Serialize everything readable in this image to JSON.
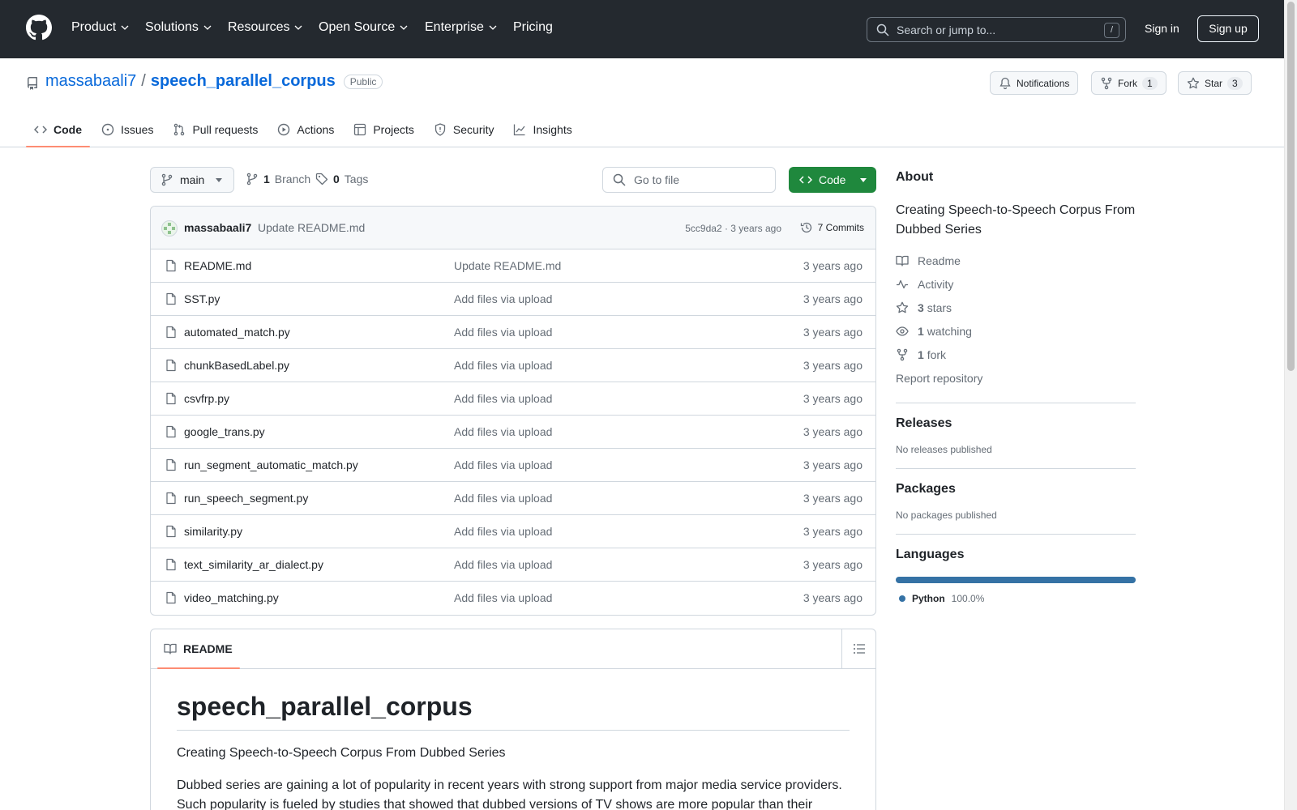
{
  "header": {
    "nav": [
      {
        "label": "Product",
        "has_menu": true
      },
      {
        "label": "Solutions",
        "has_menu": true
      },
      {
        "label": "Resources",
        "has_menu": true
      },
      {
        "label": "Open Source",
        "has_menu": true
      },
      {
        "label": "Enterprise",
        "has_menu": true
      },
      {
        "label": "Pricing",
        "has_menu": false
      }
    ],
    "search_placeholder": "Search or jump to...",
    "search_shortcut": "/",
    "sign_in": "Sign in",
    "sign_up": "Sign up"
  },
  "repo": {
    "owner": "massabaali7",
    "separator": "/",
    "name": "speech_parallel_corpus",
    "visibility": "Public",
    "notifications_label": "Notifications",
    "fork_label": "Fork",
    "fork_count": "1",
    "star_label": "Star",
    "star_count": "3"
  },
  "tabs": [
    {
      "label": "Code",
      "icon": "code-icon",
      "active": true
    },
    {
      "label": "Issues",
      "icon": "issue-icon",
      "active": false
    },
    {
      "label": "Pull requests",
      "icon": "pull-request-icon",
      "active": false
    },
    {
      "label": "Actions",
      "icon": "play-icon",
      "active": false
    },
    {
      "label": "Projects",
      "icon": "table-icon",
      "active": false
    },
    {
      "label": "Security",
      "icon": "shield-icon",
      "active": false
    },
    {
      "label": "Insights",
      "icon": "graph-icon",
      "active": false
    }
  ],
  "toolbar": {
    "branch": "main",
    "branch_count": "1",
    "branch_word": "Branch",
    "tag_count": "0",
    "tag_word": "Tags",
    "goto_placeholder": "Go to file",
    "code_label": "Code"
  },
  "latest_commit": {
    "author": "massabaali7",
    "message": "Update README.md",
    "meta": "5cc9da2 · 3 years ago",
    "commits": "7 Commits"
  },
  "files": [
    {
      "name": "README.md",
      "message": "Update README.md",
      "time": "3 years ago"
    },
    {
      "name": "SST.py",
      "message": "Add files via upload",
      "time": "3 years ago"
    },
    {
      "name": "automated_match.py",
      "message": "Add files via upload",
      "time": "3 years ago"
    },
    {
      "name": "chunkBasedLabel.py",
      "message": "Add files via upload",
      "time": "3 years ago"
    },
    {
      "name": "csvfrp.py",
      "message": "Add files via upload",
      "time": "3 years ago"
    },
    {
      "name": "google_trans.py",
      "message": "Add files via upload",
      "time": "3 years ago"
    },
    {
      "name": "run_segment_automatic_match.py",
      "message": "Add files via upload",
      "time": "3 years ago"
    },
    {
      "name": "run_speech_segment.py",
      "message": "Add files via upload",
      "time": "3 years ago"
    },
    {
      "name": "similarity.py",
      "message": "Add files via upload",
      "time": "3 years ago"
    },
    {
      "name": "text_similarity_ar_dialect.py",
      "message": "Add files via upload",
      "time": "3 years ago"
    },
    {
      "name": "video_matching.py",
      "message": "Add files via upload",
      "time": "3 years ago"
    }
  ],
  "readme": {
    "tab_label": "README",
    "title": "speech_parallel_corpus",
    "subtitle": "Creating Speech-to-Speech Corpus From Dubbed Series",
    "paragraph": "Dubbed series are gaining a lot of popularity in recent years with strong support from major media service providers. Such popularity is fueled by studies that showed that dubbed versions of TV shows are more popular than their"
  },
  "sidebar": {
    "about_title": "About",
    "description": "Creating Speech-to-Speech Corpus From Dubbed Series",
    "readme_label": "Readme",
    "activity_label": "Activity",
    "stars_count": "3",
    "stars_word": "stars",
    "watching_count": "1",
    "watching_word": "watching",
    "fork_count": "1",
    "fork_word": "fork",
    "report_label": "Report repository",
    "releases_title": "Releases",
    "releases_empty": "No releases published",
    "packages_title": "Packages",
    "packages_empty": "No packages published",
    "languages_title": "Languages",
    "languages": [
      {
        "name": "Python",
        "percent": "100.0%",
        "color": "#3572a5"
      }
    ]
  }
}
